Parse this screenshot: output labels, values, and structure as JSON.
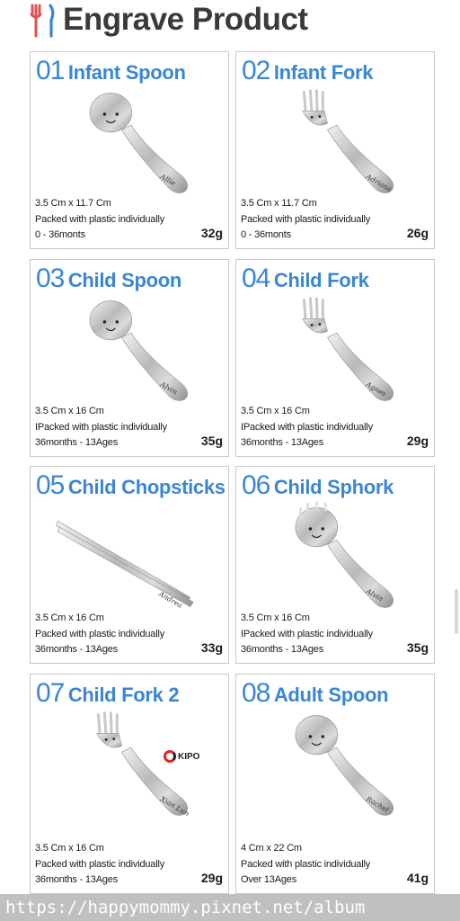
{
  "header": {
    "title": "Engrave Product",
    "icon": "cutlery-icon"
  },
  "products": [
    {
      "num": "01",
      "name": "Infant Spoon",
      "size": "3.5 Cm x 11.7 Cm",
      "pack": "Packed with plastic individually",
      "age": "0 - 36monts",
      "weight": "32g",
      "engraving": "Allie",
      "type": "spoon"
    },
    {
      "num": "02",
      "name": "Infant Fork",
      "size": "3.5 Cm x 11.7 Cm",
      "pack": "Packed with plastic individually",
      "age": "0 - 36monts",
      "weight": "26g",
      "engraving": "Adriana",
      "type": "fork"
    },
    {
      "num": "03",
      "name": "Child Spoon",
      "size": "3.5 Cm x 16 Cm",
      "pack": "IPacked with plastic individually",
      "age": "36months - 13Ages",
      "weight": "35g",
      "engraving": "Alvin",
      "type": "spoon"
    },
    {
      "num": "04",
      "name": "Child Fork",
      "size": "3.5 Cm x 16 Cm",
      "pack": "IPacked with plastic individually",
      "age": "36months - 13Ages",
      "weight": "29g",
      "engraving": "Agnes",
      "type": "fork"
    },
    {
      "num": "05",
      "name": "Child Chopsticks",
      "size": "3.5 Cm x 16 Cm",
      "pack": "Packed with plastic individually",
      "age": "36months - 13Ages",
      "weight": "33g",
      "engraving": "Andrea",
      "type": "chopsticks"
    },
    {
      "num": "06",
      "name": "Child Sphork",
      "size": "3.5 Cm x 16 Cm",
      "pack": "IPacked with plastic individually",
      "age": "36months - 13Ages",
      "weight": "35g",
      "engraving": "Alvin",
      "type": "spork"
    },
    {
      "num": "07",
      "name": "Child Fork 2",
      "size": "3.5 Cm x 16 Cm",
      "pack": "Packed with plastic individually",
      "age": "36months - 13Ages",
      "weight": "29g",
      "engraving": "Xian Lun",
      "type": "fork2",
      "logo": "KIPO"
    },
    {
      "num": "08",
      "name": "Adult Spoon",
      "size": "4 Cm x 22 Cm",
      "pack": "Packed with plastic individually",
      "age": "Over 13Ages",
      "weight": "41g",
      "engraving": "Rachel",
      "type": "spoon"
    }
  ],
  "watermark": "https://happymommy.pixnet.net/album",
  "colors": {
    "accent": "#3a86d4",
    "title": "#3a3a3a",
    "header_icon_red": "#e05050",
    "header_icon_blue": "#3a86d4"
  }
}
